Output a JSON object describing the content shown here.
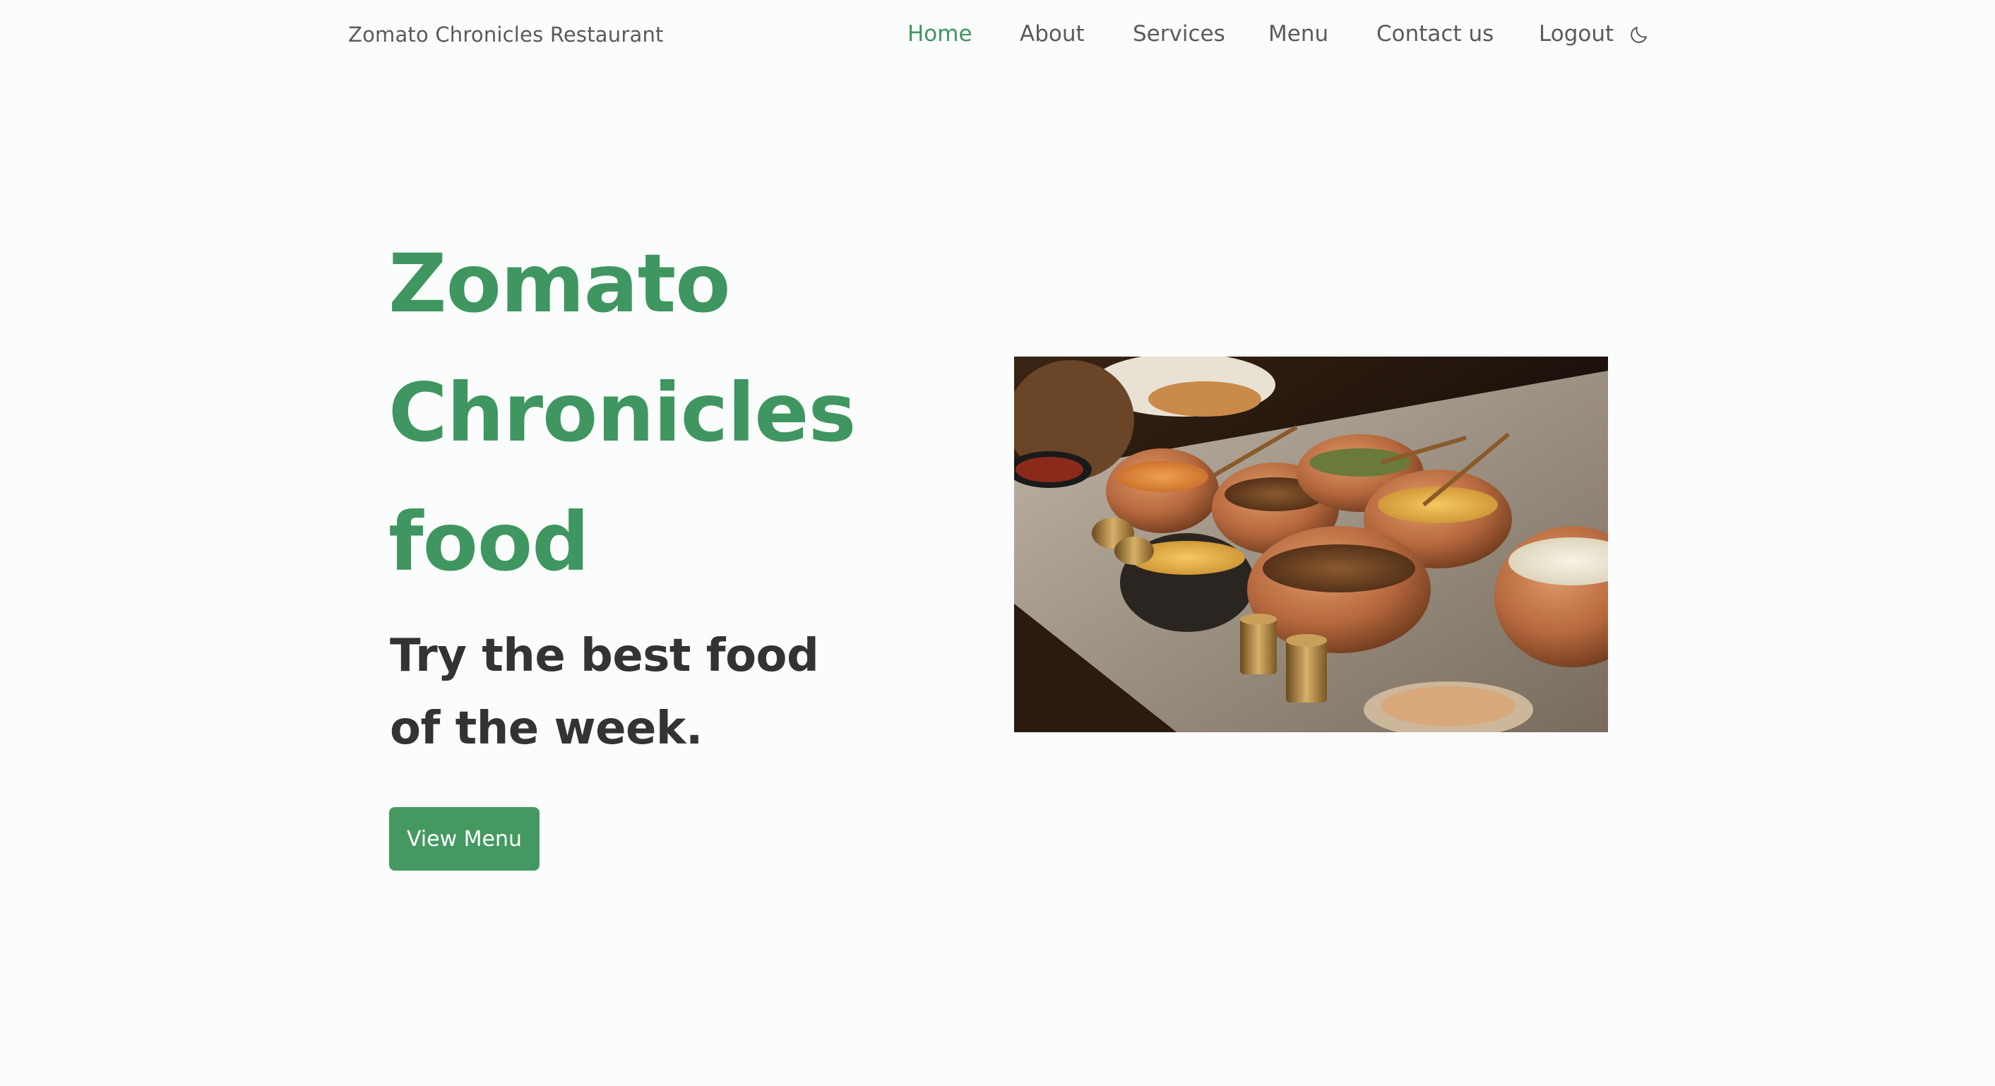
{
  "header": {
    "brand": "Zomato Chronicles Restaurant",
    "nav": [
      {
        "label": "Home",
        "active": true
      },
      {
        "label": "About",
        "active": false
      },
      {
        "label": "Services",
        "active": false
      },
      {
        "label": "Menu",
        "active": false
      },
      {
        "label": "Contact us",
        "active": false
      },
      {
        "label": "Logout",
        "active": false
      }
    ],
    "theme_toggle_icon": "moon-icon"
  },
  "hero": {
    "title_line1": "Zomato",
    "title_line2": "Chronicles",
    "title_line3": "food",
    "subtitle": "Try the best food of the week.",
    "cta_label": "View Menu",
    "image_subject": "food-platter-image"
  },
  "colors": {
    "accent": "#3f9660",
    "button": "#449961",
    "text_dark": "#333333",
    "nav_text": "#5a5a5a",
    "background": "#fbfdfc"
  }
}
